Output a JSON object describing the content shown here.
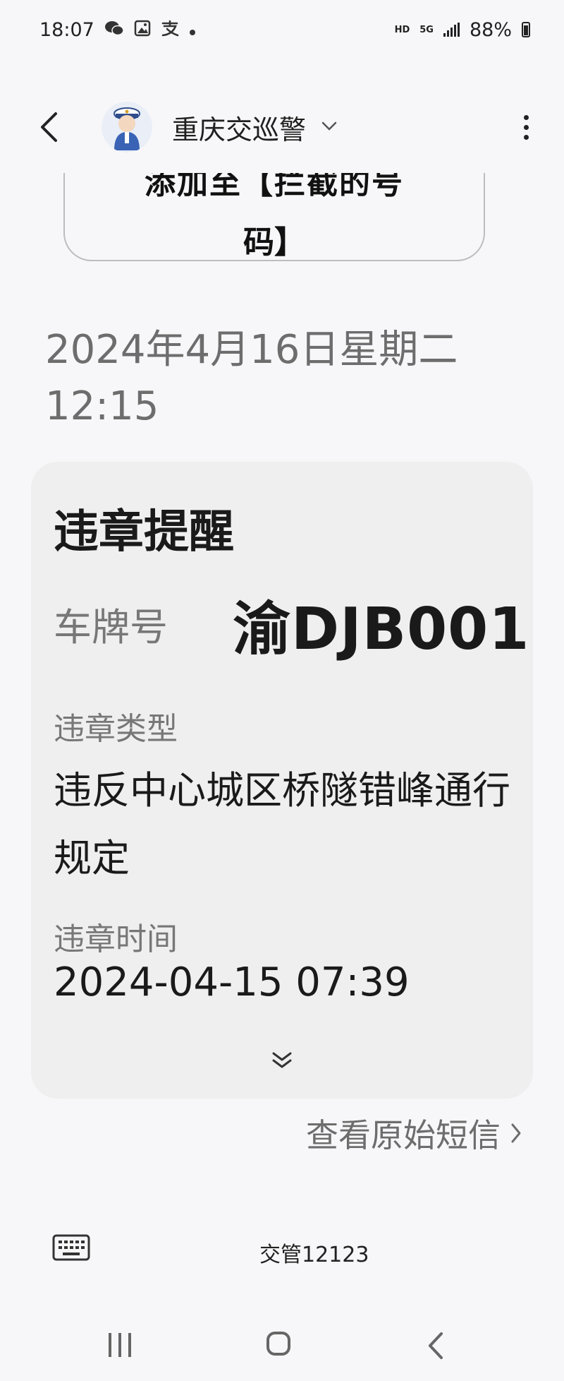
{
  "status_bar": {
    "time": "18:07",
    "network_hd": "HD",
    "network_5g": "5G",
    "battery": "88%"
  },
  "header": {
    "contact_name": "重庆交巡警"
  },
  "previous_message": {
    "line1": "添加至【拦截的号",
    "line2": "码】"
  },
  "date_separator": "2024年4月16日星期二 12:15",
  "card": {
    "title": "违章提醒",
    "plate_label": "车牌号",
    "plate_value": "渝DJB001",
    "type_label": "违章类型",
    "type_value": "违反中心城区桥隧错峰通行规定",
    "time_label": "违章时间",
    "time_value": "2024-04-15 07:39"
  },
  "view_original_label": "查看原始短信",
  "bottom": {
    "shortcode": "交管12123"
  },
  "icons": {
    "status": [
      "wechat-icon",
      "gallery-icon",
      "alipay-icon",
      "dot-icon",
      "signal-icon",
      "battery-icon"
    ],
    "header": [
      "back-icon",
      "avatar-police-icon",
      "chevron-down-icon",
      "more-vert-icon"
    ],
    "card": [
      "double-chevron-down-icon"
    ],
    "nav": [
      "recent-apps-icon",
      "home-icon",
      "nav-back-icon"
    ]
  },
  "colors": {
    "background": "#f7f7f9",
    "card": "#efefef",
    "muted_text": "#6d6d6d"
  }
}
